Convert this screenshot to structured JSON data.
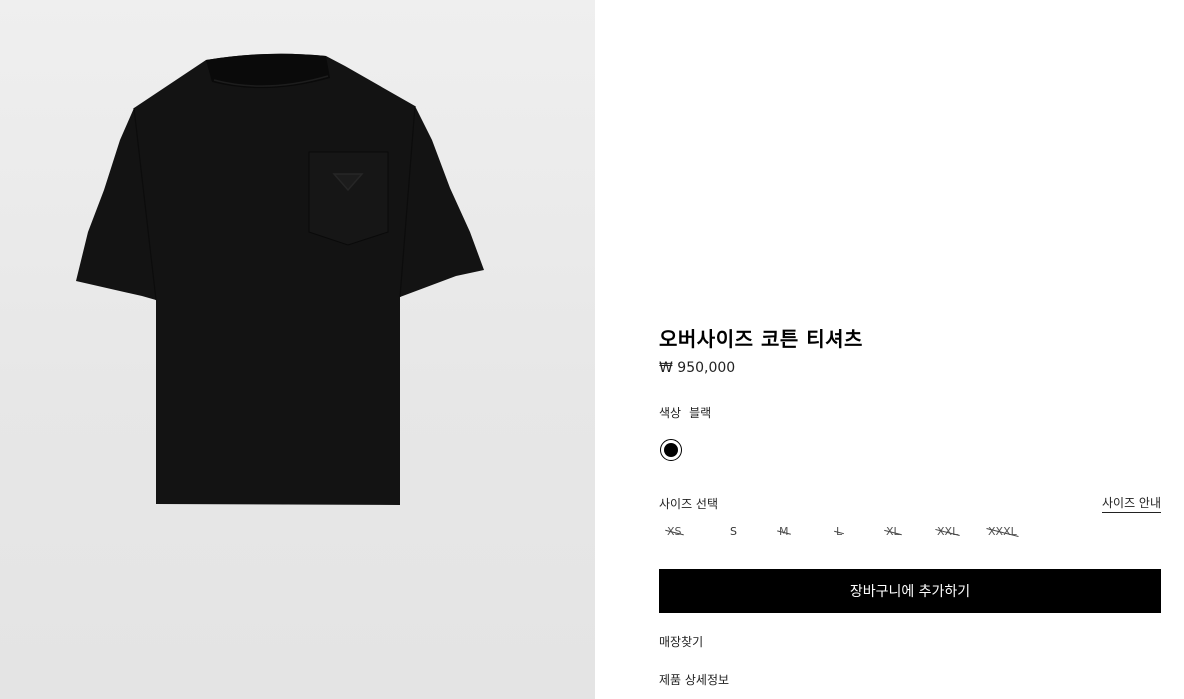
{
  "product": {
    "title": "오버사이즈 코튼 티셔츠",
    "price": "₩ 950,000",
    "image_alt": "black oversized cotton t-shirt with triangle logo pocket"
  },
  "color": {
    "label": "색상",
    "value": "블랙",
    "swatch_hex": "#000000"
  },
  "size": {
    "label": "사이즈 선택",
    "guide_label": "사이즈 안내",
    "options": [
      {
        "label": "XS",
        "available": false
      },
      {
        "label": "S",
        "available": true
      },
      {
        "label": "M",
        "available": false
      },
      {
        "label": "L",
        "available": false
      },
      {
        "label": "XL",
        "available": false
      },
      {
        "label": "XXL",
        "available": false
      },
      {
        "label": "XXXL",
        "available": false
      }
    ]
  },
  "actions": {
    "add_to_cart": "장바구니에 추가하기",
    "find_store": "매장찾기",
    "product_details": "제품 상세정보"
  },
  "colors": {
    "primary_button_bg": "#000000",
    "primary_button_text": "#ffffff",
    "image_background": "#e9e9e9"
  }
}
